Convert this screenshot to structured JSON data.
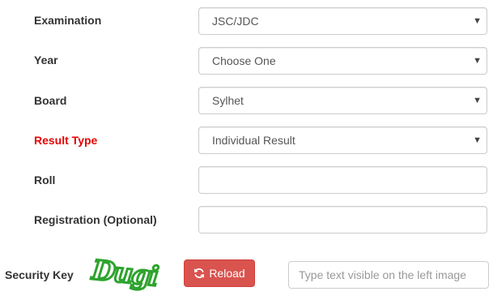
{
  "form": {
    "examination": {
      "label": "Examination",
      "value": "JSC/JDC"
    },
    "year": {
      "label": "Year",
      "value": "Choose One"
    },
    "board": {
      "label": "Board",
      "value": "Sylhet"
    },
    "result_type": {
      "label": "Result Type",
      "value": "Individual Result",
      "label_color": "#e60000"
    },
    "roll": {
      "label": "Roll",
      "value": ""
    },
    "registration": {
      "label": "Registration (Optional)",
      "value": ""
    }
  },
  "security": {
    "label": "Security Key",
    "captcha_text": "Dugi",
    "captcha_color": "#2ea32e",
    "reload_label": "Reload",
    "reload_icon": "refresh-icon",
    "reload_color": "#d9534f",
    "input_placeholder": "Type text visible on the left image"
  }
}
